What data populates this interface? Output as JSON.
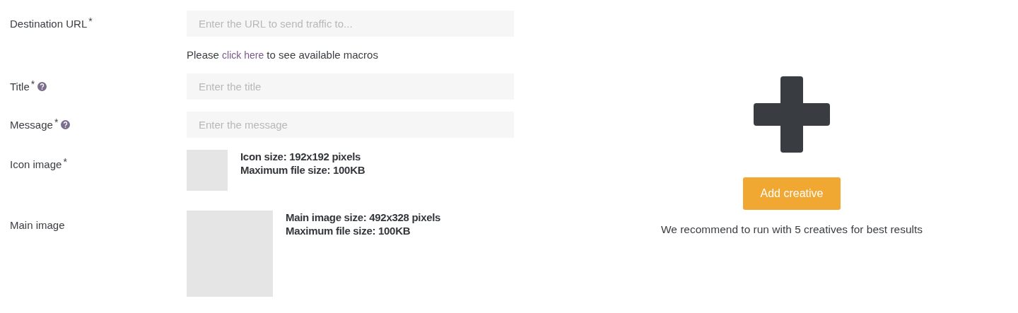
{
  "form": {
    "rows": [
      {
        "kind": "text",
        "label": "Destination URL",
        "required_mark": "*",
        "help": false,
        "placeholder": "Enter the URL to send traffic to...",
        "note": {
          "before": "Please",
          "link": "click here",
          "after": "to see available macros"
        }
      },
      {
        "kind": "text",
        "label": "Title",
        "required_mark": "*",
        "help": true,
        "placeholder": "Enter the title"
      },
      {
        "kind": "text",
        "label": "Message",
        "required_mark": "*",
        "help": true,
        "placeholder": "Enter the message"
      },
      {
        "kind": "small_image",
        "label": "Icon image",
        "required_mark": "*",
        "help": false,
        "hints": [
          "Icon size: 192x192 pixels",
          "Maximum file size: 100KB"
        ]
      },
      {
        "kind": "large_image",
        "label": "Main image",
        "help": false,
        "hints": [
          "Main image size: 492x328 pixels",
          "Maximum file size: 100KB"
        ]
      }
    ]
  },
  "creative_panel": {
    "button": "Add creative",
    "recommendation": "We recommend to run with 5 creatives for best results"
  }
}
